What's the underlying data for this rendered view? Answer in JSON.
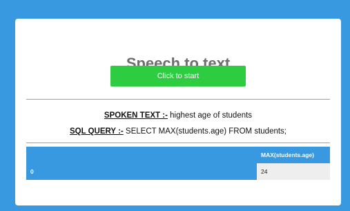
{
  "header": {
    "title": "Speech to text",
    "start_button_label": "Click to start"
  },
  "spoken": {
    "label": "SPOKEN TEXT :-",
    "text": " highest age of students"
  },
  "sql": {
    "label": "SQL QUERY :-",
    "text": " SELECT MAX(students.age) FROM students;"
  },
  "results": {
    "index_header": "",
    "columns": [
      "MAX(students.age)"
    ],
    "rows": [
      {
        "index": "0",
        "values": [
          "24"
        ]
      }
    ]
  },
  "colors": {
    "background": "#3898e0",
    "button": "#2ecc40",
    "table_header": "#3898e0",
    "cell_background": "#eeeeee"
  }
}
